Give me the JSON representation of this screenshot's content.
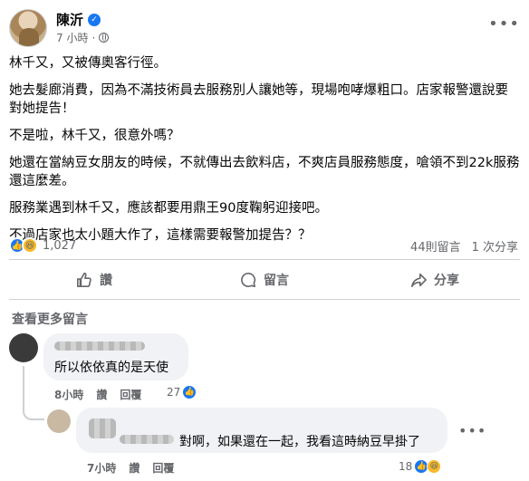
{
  "post": {
    "author": "陳沂",
    "time": "7 小時",
    "paragraphs": [
      "林千又，又被傳奧客行徑。",
      "她去髮廊消費，因為不滿技術員去服務別人讓她等，現場咆哮爆粗口。店家報警還說要對她提告！",
      "不是啦，林千又，很意外嗎？",
      "她還在當納豆女朋友的時候，不就傳出去飲料店，不爽店員服務態度，嗆領不到22k服務還這麼差。",
      "服務業遇到林千又，應該都要用鼎王90度鞠躬迎接吧。",
      "不過店家也太小題大作了，這樣需要報警加提告？？"
    ]
  },
  "stats": {
    "reaction_count": "1,027",
    "comments": "44則留言",
    "shares": "1 次分享"
  },
  "actions": {
    "like": "讚",
    "comment": "留言",
    "share": "分享"
  },
  "view_more": "查看更多留言",
  "comments": [
    {
      "text": "所以依依真的是天使",
      "time": "8小時",
      "like": "讚",
      "reply": "回覆",
      "react_count": "27"
    },
    {
      "text": "對啊，如果還在一起，我看這時納豆早掛了",
      "time": "7小時",
      "like": "讚",
      "reply": "回覆",
      "react_count": "18"
    }
  ],
  "colors": {
    "facebook_blue": "#1877f2",
    "muted_text": "#65676b",
    "bubble_bg": "#f0f2f5"
  }
}
